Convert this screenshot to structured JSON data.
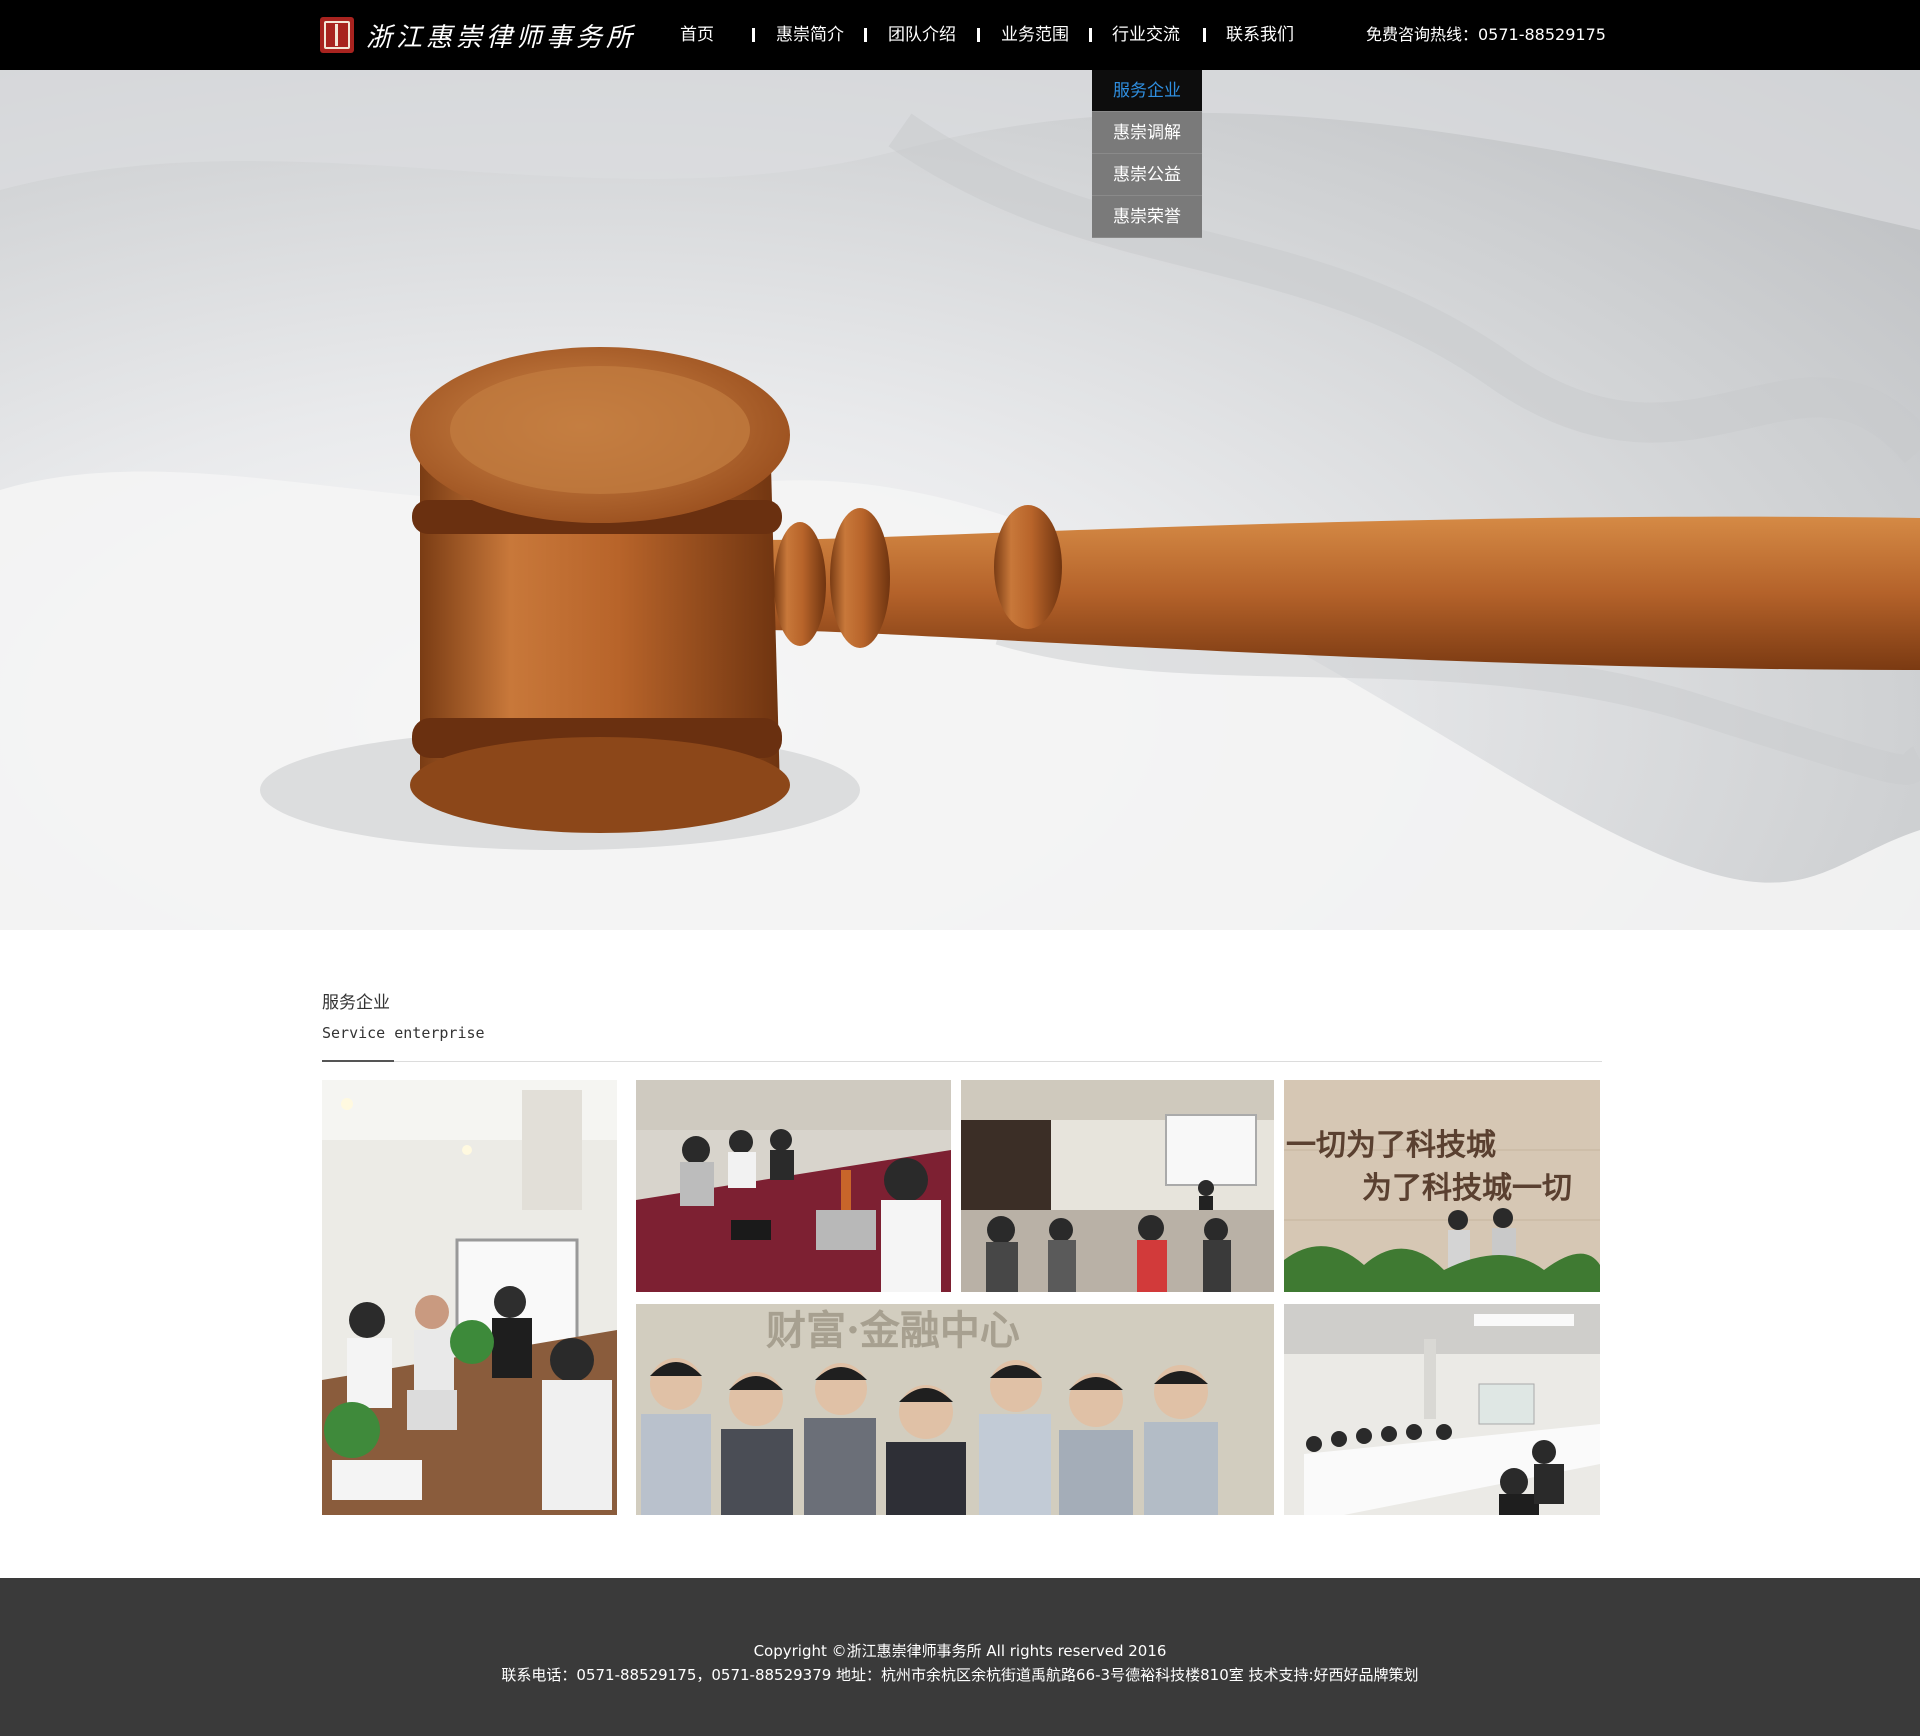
{
  "header": {
    "logo_text": "浙江惠崇律师事务所",
    "nav": [
      {
        "label": "首页"
      },
      {
        "label": "惠崇简介"
      },
      {
        "label": "团队介绍"
      },
      {
        "label": "业务范围"
      },
      {
        "label": "行业交流"
      },
      {
        "label": "联系我们"
      }
    ],
    "hotline": "免费咨询热线：0571-88529175"
  },
  "dropdown": {
    "items": [
      {
        "label": "服务企业",
        "active": true
      },
      {
        "label": "惠崇调解",
        "active": false
      },
      {
        "label": "惠崇公益",
        "active": false
      },
      {
        "label": "惠崇荣誉",
        "active": false
      }
    ]
  },
  "section": {
    "title": "服务企业",
    "subtitle": "Service enterprise",
    "photo_wall_text": {
      "line1": "一切为了科技城",
      "line2": "为了科技城一切"
    },
    "banner_text": "财富·金融中心"
  },
  "footer": {
    "copyright": "Copyright ©浙江惠崇律师事务所 All rights reserved 2016",
    "contact": "联系电话：0571-88529175，0571-88529379 地址：杭州市余杭区余杭街道禹航路66-3号德裕科技楼810室 技术支持:好西好品牌策划"
  },
  "colors": {
    "header_bg": "#000000",
    "dropdown_active_text": "#2f8fe0",
    "dropdown_bg": "#7a7a7a",
    "footer_bg": "#3a3a3a",
    "gavel_wood": "#b4622a"
  }
}
